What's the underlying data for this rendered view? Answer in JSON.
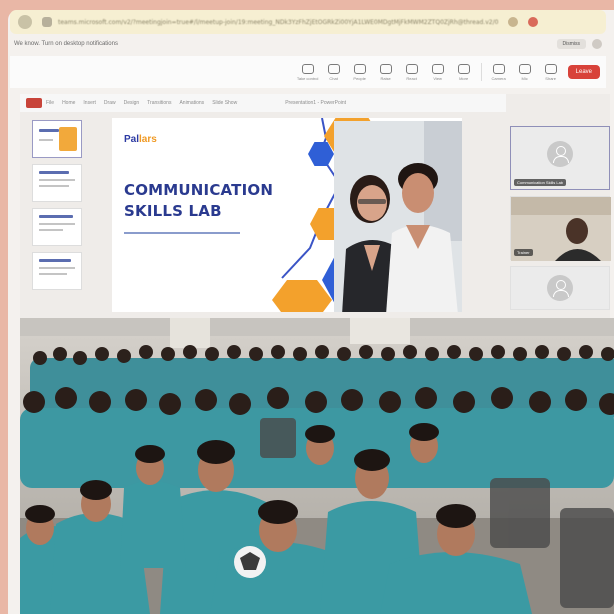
{
  "browser": {
    "url": "teams.microsoft.com/v2/?meetingjoin=true#/l/meetup-join/19:meeting_NDk3YzFhZjEtOGRkZi00YjA1LWE0MDgtMjFkMWM2ZTQ0ZjRh@thread.v2/0"
  },
  "notice": {
    "message": "We know. Turn on desktop notifications",
    "dismiss": "Dismiss"
  },
  "toolbar": {
    "items": [
      "Take control",
      "Chat",
      "People",
      "Raise",
      "React",
      "View",
      "More",
      "Camera",
      "Mic",
      "Share"
    ],
    "leave": "Leave"
  },
  "ppt": {
    "menus": [
      "File",
      "Home",
      "Insert",
      "Draw",
      "Design",
      "Transitions",
      "Animations",
      "Slide Show"
    ],
    "doc_title": "Presentation1 - PowerPoint"
  },
  "slide": {
    "brand_a": "Pal",
    "brand_b": "lars",
    "title": "COMMUNICATION\nSKILLS LAB"
  },
  "participants": [
    {
      "name": "Communication Skills Lab"
    },
    {
      "name": "Trainer"
    }
  ],
  "colors": {
    "title_navy": "#2a3a8f",
    "hex_orange": "#f3a12c",
    "hex_blue": "#2f5fd6",
    "uniform_teal": "#3e9aa3",
    "leave_red": "#d8423a"
  }
}
